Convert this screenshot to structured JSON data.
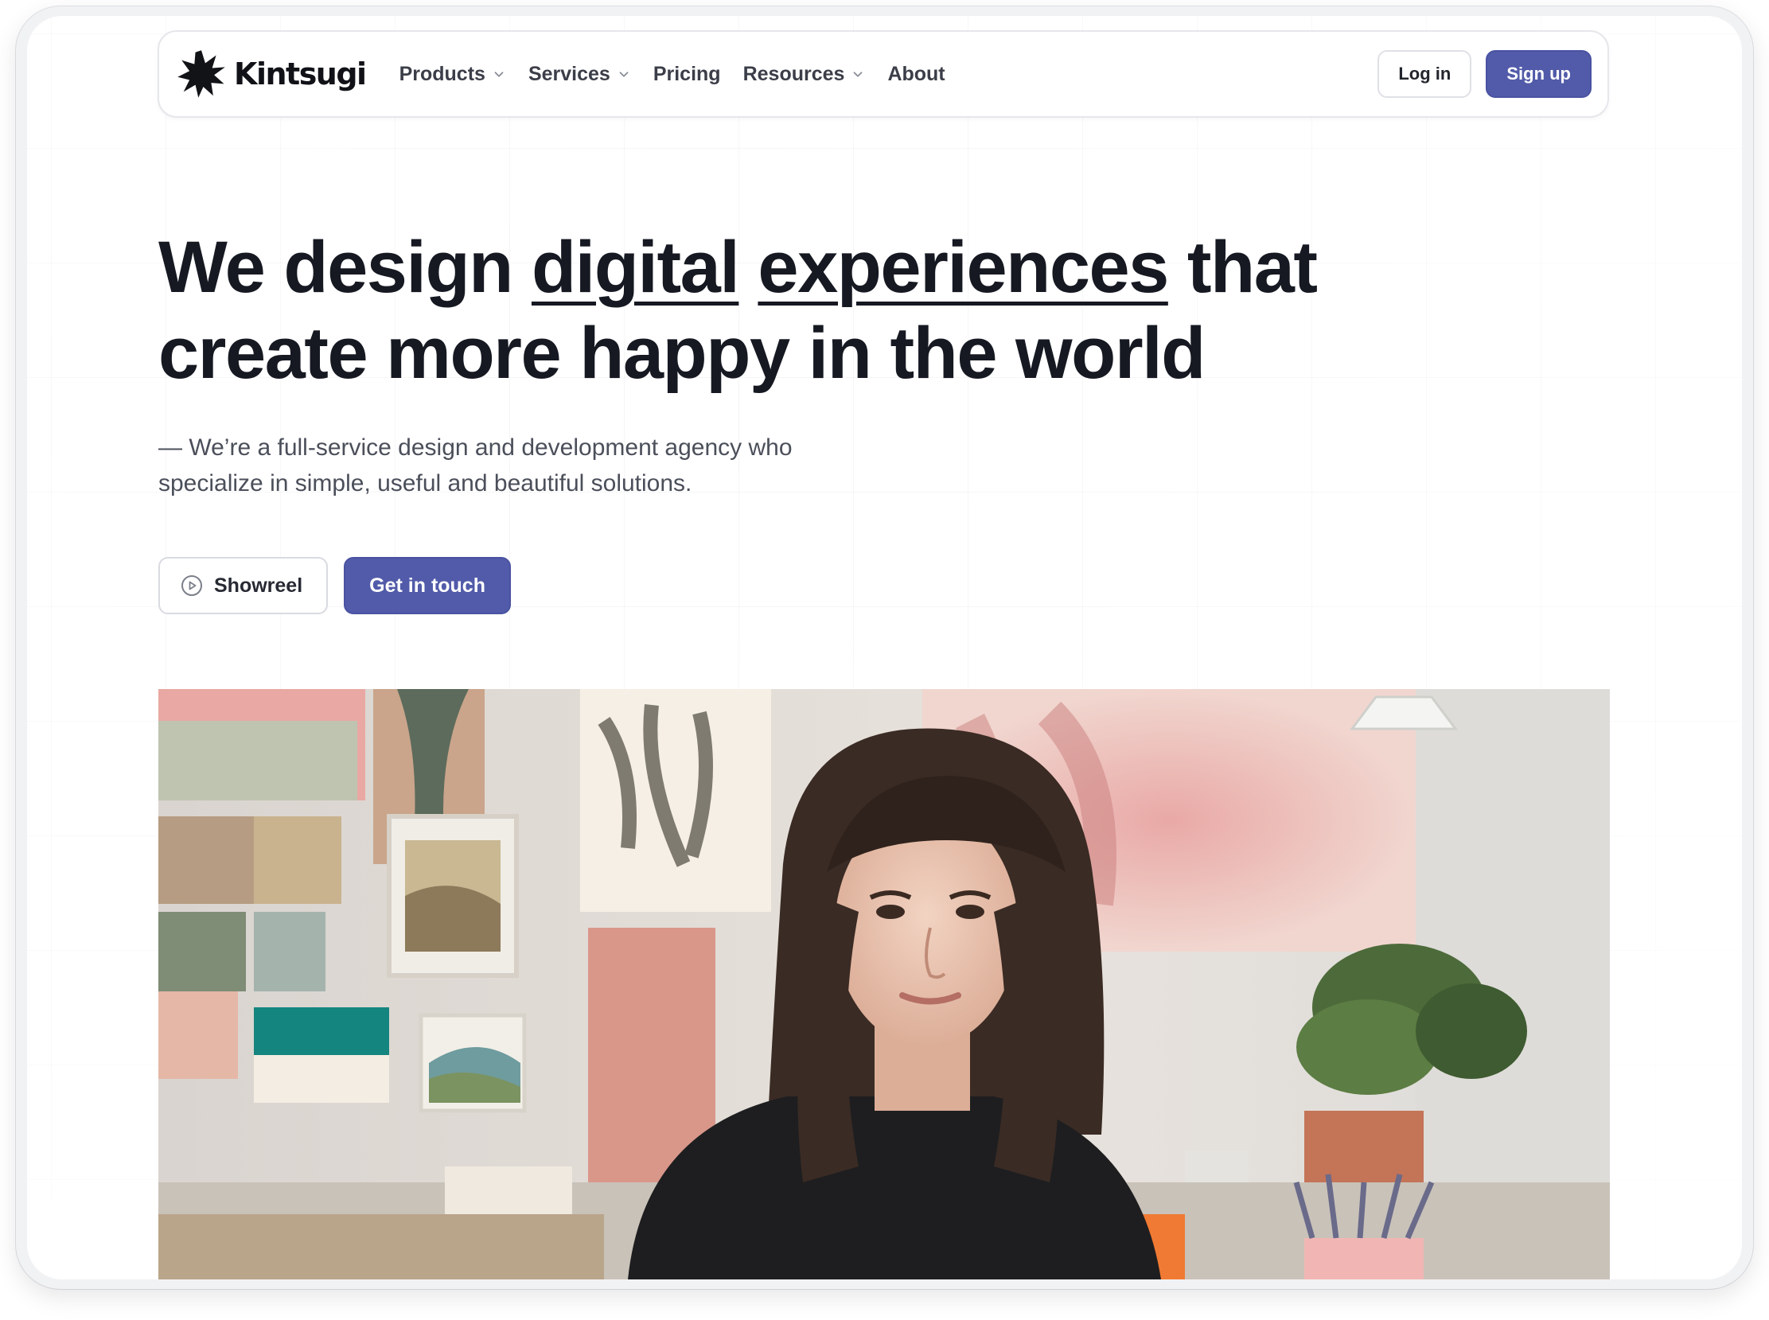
{
  "brand": {
    "name": "Kintsugi",
    "logo_icon": "starburst-icon",
    "accent": "#525ba9"
  },
  "nav": {
    "items": [
      {
        "label": "Products",
        "has_dropdown": true
      },
      {
        "label": "Services",
        "has_dropdown": true
      },
      {
        "label": "Pricing",
        "has_dropdown": false
      },
      {
        "label": "Resources",
        "has_dropdown": true
      },
      {
        "label": "About",
        "has_dropdown": false
      }
    ],
    "login_label": "Log in",
    "signup_label": "Sign up"
  },
  "hero": {
    "headline_before": "We design ",
    "headline_u1": "digital",
    "headline_mid": " ",
    "headline_u2": "experiences",
    "headline_after": " that create more happy in the world",
    "subtitle": "— We’re a full-service design and development agency who specialize in simple, useful and beautiful solutions.",
    "showreel_label": "Showreel",
    "showreel_icon": "play-circle-icon",
    "cta_label": "Get in touch"
  },
  "photo": {
    "subject": "woman-in-studio-photo"
  }
}
